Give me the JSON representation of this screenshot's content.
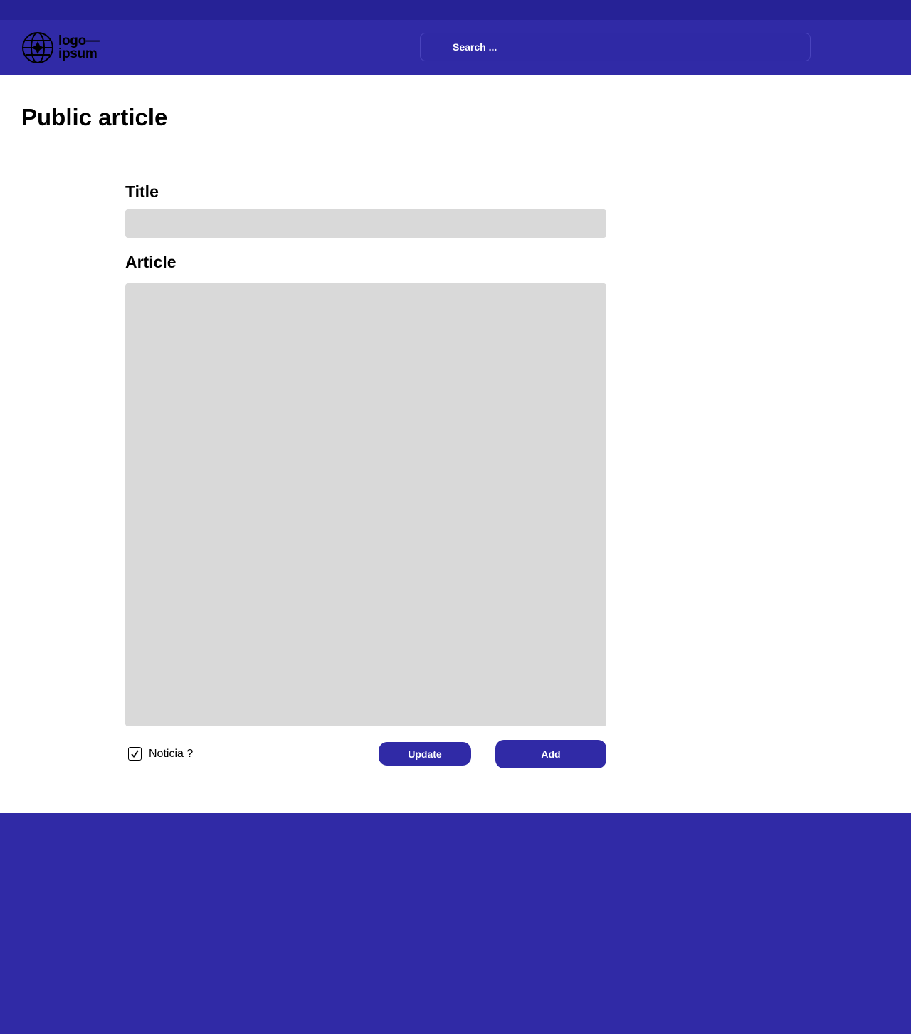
{
  "header": {
    "logo": {
      "line1": "logo—",
      "line2": "ipsum"
    },
    "search": {
      "placeholder": "Search ..."
    }
  },
  "page": {
    "title": "Public article"
  },
  "form": {
    "title_label": "Title",
    "title_value": "",
    "article_label": "Article",
    "article_value": "",
    "noticia": {
      "label": "Noticia ?",
      "checked": true
    },
    "update_label": "Update",
    "add_label": "Add"
  },
  "colors": {
    "brand": "#302aa6",
    "topstrip": "#262296",
    "field": "#d9d9d9"
  }
}
